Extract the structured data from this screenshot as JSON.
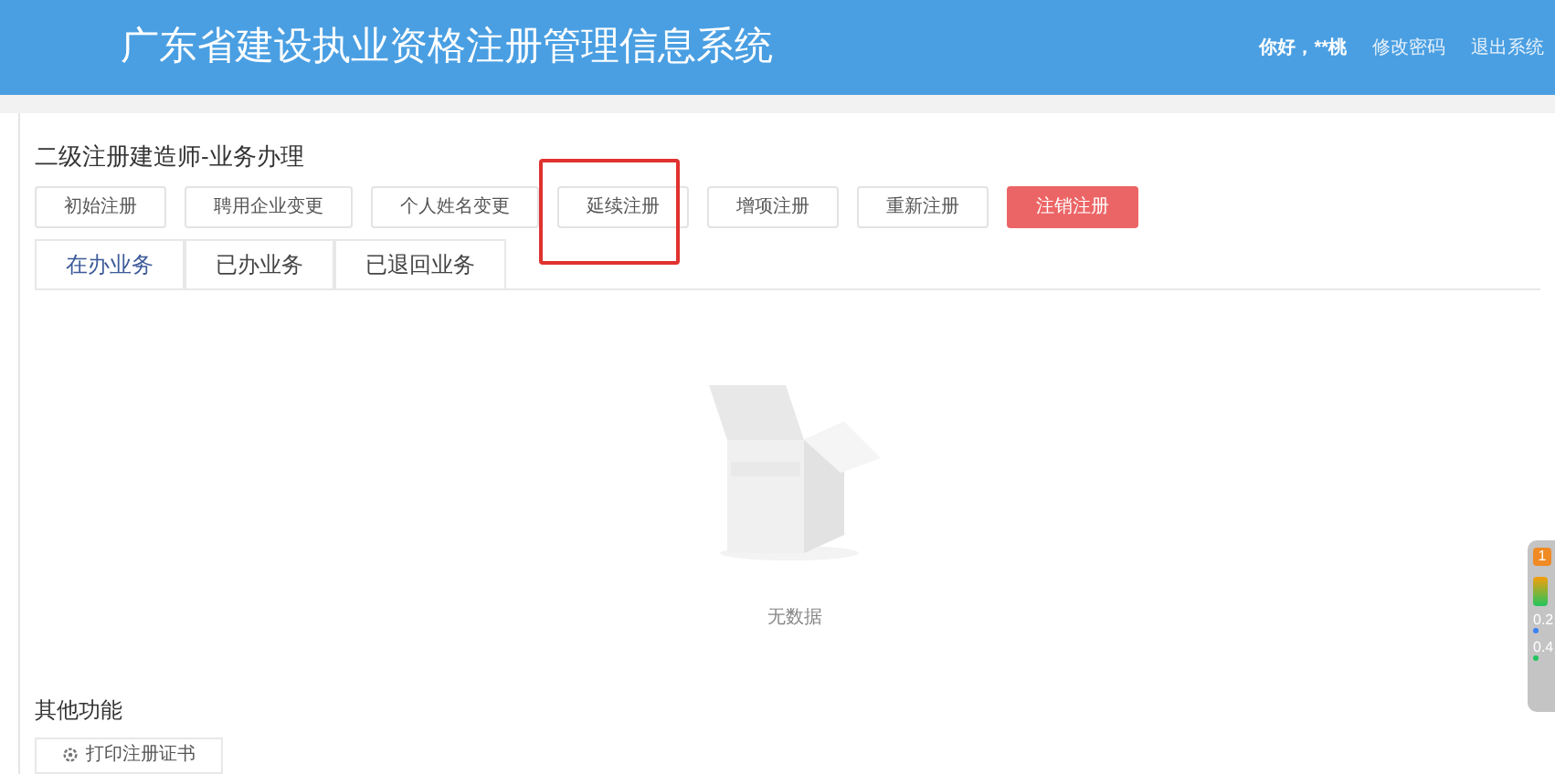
{
  "header": {
    "title": "广东省建设执业资格注册管理信息系统",
    "greeting": "你好，**桃",
    "links": [
      "修改密码",
      "退出系统"
    ]
  },
  "section": {
    "title": "二级注册建造师-业务办理"
  },
  "actions": [
    {
      "label": "初始注册",
      "kind": "normal",
      "highlighted": false
    },
    {
      "label": "聘用企业变更",
      "kind": "normal",
      "highlighted": false
    },
    {
      "label": "个人姓名变更",
      "kind": "normal",
      "highlighted": false
    },
    {
      "label": "延续注册",
      "kind": "normal",
      "highlighted": true
    },
    {
      "label": "增项注册",
      "kind": "normal",
      "highlighted": false
    },
    {
      "label": "重新注册",
      "kind": "normal",
      "highlighted": false
    },
    {
      "label": "注销注册",
      "kind": "danger",
      "highlighted": false
    }
  ],
  "tabs": [
    {
      "label": "在办业务",
      "selected": true
    },
    {
      "label": "已办业务",
      "selected": false
    },
    {
      "label": "已退回业务",
      "selected": false
    }
  ],
  "empty": {
    "text": "无数据"
  },
  "other": {
    "title": "其他功能",
    "button": "打印注册证书"
  },
  "widget": {
    "badge": "1",
    "readings": [
      {
        "text": "0.2",
        "color": "#3b82f6"
      },
      {
        "text": "0.4",
        "color": "#22c55e"
      }
    ]
  }
}
